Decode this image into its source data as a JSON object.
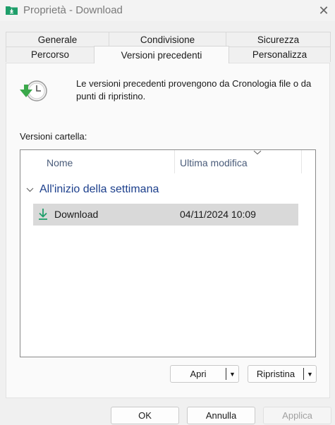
{
  "window": {
    "title": "Proprietà - Download"
  },
  "tabs_row1": [
    "Generale",
    "Condivisione",
    "Sicurezza"
  ],
  "tabs_row2": [
    "Percorso",
    "Versioni precedenti",
    "Personalizza"
  ],
  "active_tab": "Versioni precedenti",
  "info": {
    "text": "Le versioni precedenti provengono da Cronologia file o da punti di ripristino."
  },
  "versions": {
    "label": "Versioni cartella:",
    "columns": [
      "Nome",
      "Ultima modifica"
    ],
    "groups": [
      {
        "title": "All'inizio della settimana",
        "items": [
          {
            "name": "Download",
            "modified": "04/11/2024 10:09"
          }
        ]
      }
    ]
  },
  "actions": {
    "open": "Apri",
    "restore": "Ripristina"
  },
  "footer": {
    "ok": "OK",
    "cancel": "Annulla",
    "apply": "Applica"
  },
  "colors": {
    "accent": "#1c3f8c",
    "folder_green": "#1e9e6a",
    "selection": "#d9d9d9"
  }
}
